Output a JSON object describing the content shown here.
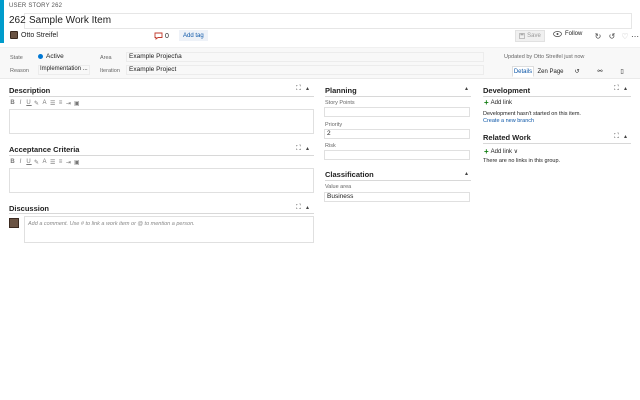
{
  "header": {
    "work_item_type": "USER STORY 262",
    "id": "262",
    "title": "Sample Work Item",
    "assigned_to": "Otto Streifel",
    "comment_count": "0",
    "add_tag_label": "Add tag",
    "save_label": "Save",
    "follow_label": "Follow"
  },
  "fields": {
    "state_label": "State",
    "state_value": "Active",
    "state_color": "#0078d4",
    "reason_label": "Reason",
    "reason_value": "Implementation ...",
    "area_label": "Area",
    "area_value": "Example Project\\a",
    "iteration_label": "Iteration",
    "iteration_value": "Example Project",
    "updated_text": "Updated by Otto Streifel just now"
  },
  "tabs": {
    "details": "Details",
    "zen": "Zen Page"
  },
  "sections": {
    "description": "Description",
    "acceptance": "Acceptance Criteria",
    "discussion": "Discussion",
    "discussion_placeholder": "Add a comment. Use # to link a work item or @ to mention a person.",
    "planning": "Planning",
    "story_points_label": "Story Points",
    "story_points_value": "",
    "priority_label": "Priority",
    "priority_value": "2",
    "risk_label": "Risk",
    "risk_value": "",
    "classification": "Classification",
    "value_area_label": "Value area",
    "value_area_value": "Business",
    "development": "Development",
    "add_link": "Add link",
    "dev_empty": "Development hasn't started on this item.",
    "create_branch": "Create a new branch",
    "related_work": "Related Work",
    "related_add_link": "Add link ∨",
    "related_empty": "There are no links in this group."
  },
  "icons": [
    "user-avatar",
    "comment-icon",
    "save-icon",
    "eye-icon",
    "refresh-icon",
    "undo-icon",
    "heart-icon",
    "more-icon",
    "history-icon",
    "link-icon",
    "attachment-icon",
    "maximize-icon",
    "collapse-icon"
  ],
  "colors": {
    "accent": "#009ccc",
    "link": "#0d57a8",
    "add": "#107c10"
  }
}
